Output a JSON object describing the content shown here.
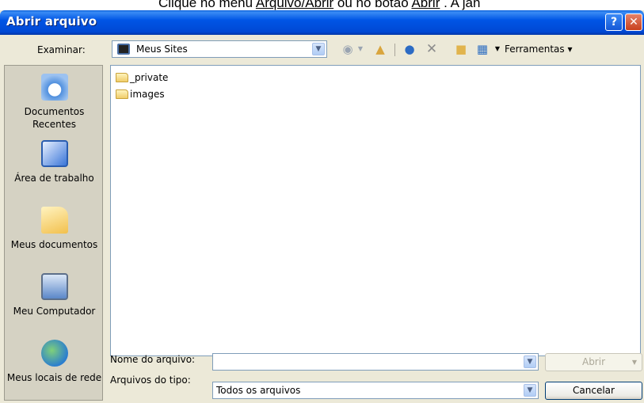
{
  "background_text": {
    "prefix": "Clique no menu ",
    "menu_path": "Arquivo/Abrir",
    "middle": " ou no botão ",
    "button_name": "Abrir",
    "suffix": " . A jan"
  },
  "dialog": {
    "title": "Abrir arquivo",
    "help_label": "?",
    "close_label": "✕"
  },
  "toolbar": {
    "look_in_label": "Examinar:",
    "look_in_value": "Meus Sites",
    "tools_label": "Ferramentas",
    "icons": [
      "back-icon",
      "up-folder-icon",
      "search-web-icon",
      "delete-icon",
      "new-folder-icon",
      "views-icon"
    ]
  },
  "places": [
    {
      "label": "Documentos Recentes",
      "icon": "recent-documents-icon"
    },
    {
      "label": "Área de trabalho",
      "icon": "desktop-icon"
    },
    {
      "label": "Meus documentos",
      "icon": "my-documents-icon"
    },
    {
      "label": "Meu Computador",
      "icon": "my-computer-icon"
    },
    {
      "label": "Meus locais de rede",
      "icon": "network-places-icon"
    }
  ],
  "files": [
    {
      "name": "_private",
      "icon": "folder-icon"
    },
    {
      "name": "images",
      "icon": "folder-icon"
    }
  ],
  "form": {
    "filename_label": "Nome do arquivo:",
    "filename_value": "",
    "filetype_label": "Arquivos do tipo:",
    "filetype_value": "Todos os arquivos"
  },
  "buttons": {
    "open": "Abrir",
    "cancel": "Cancelar"
  }
}
